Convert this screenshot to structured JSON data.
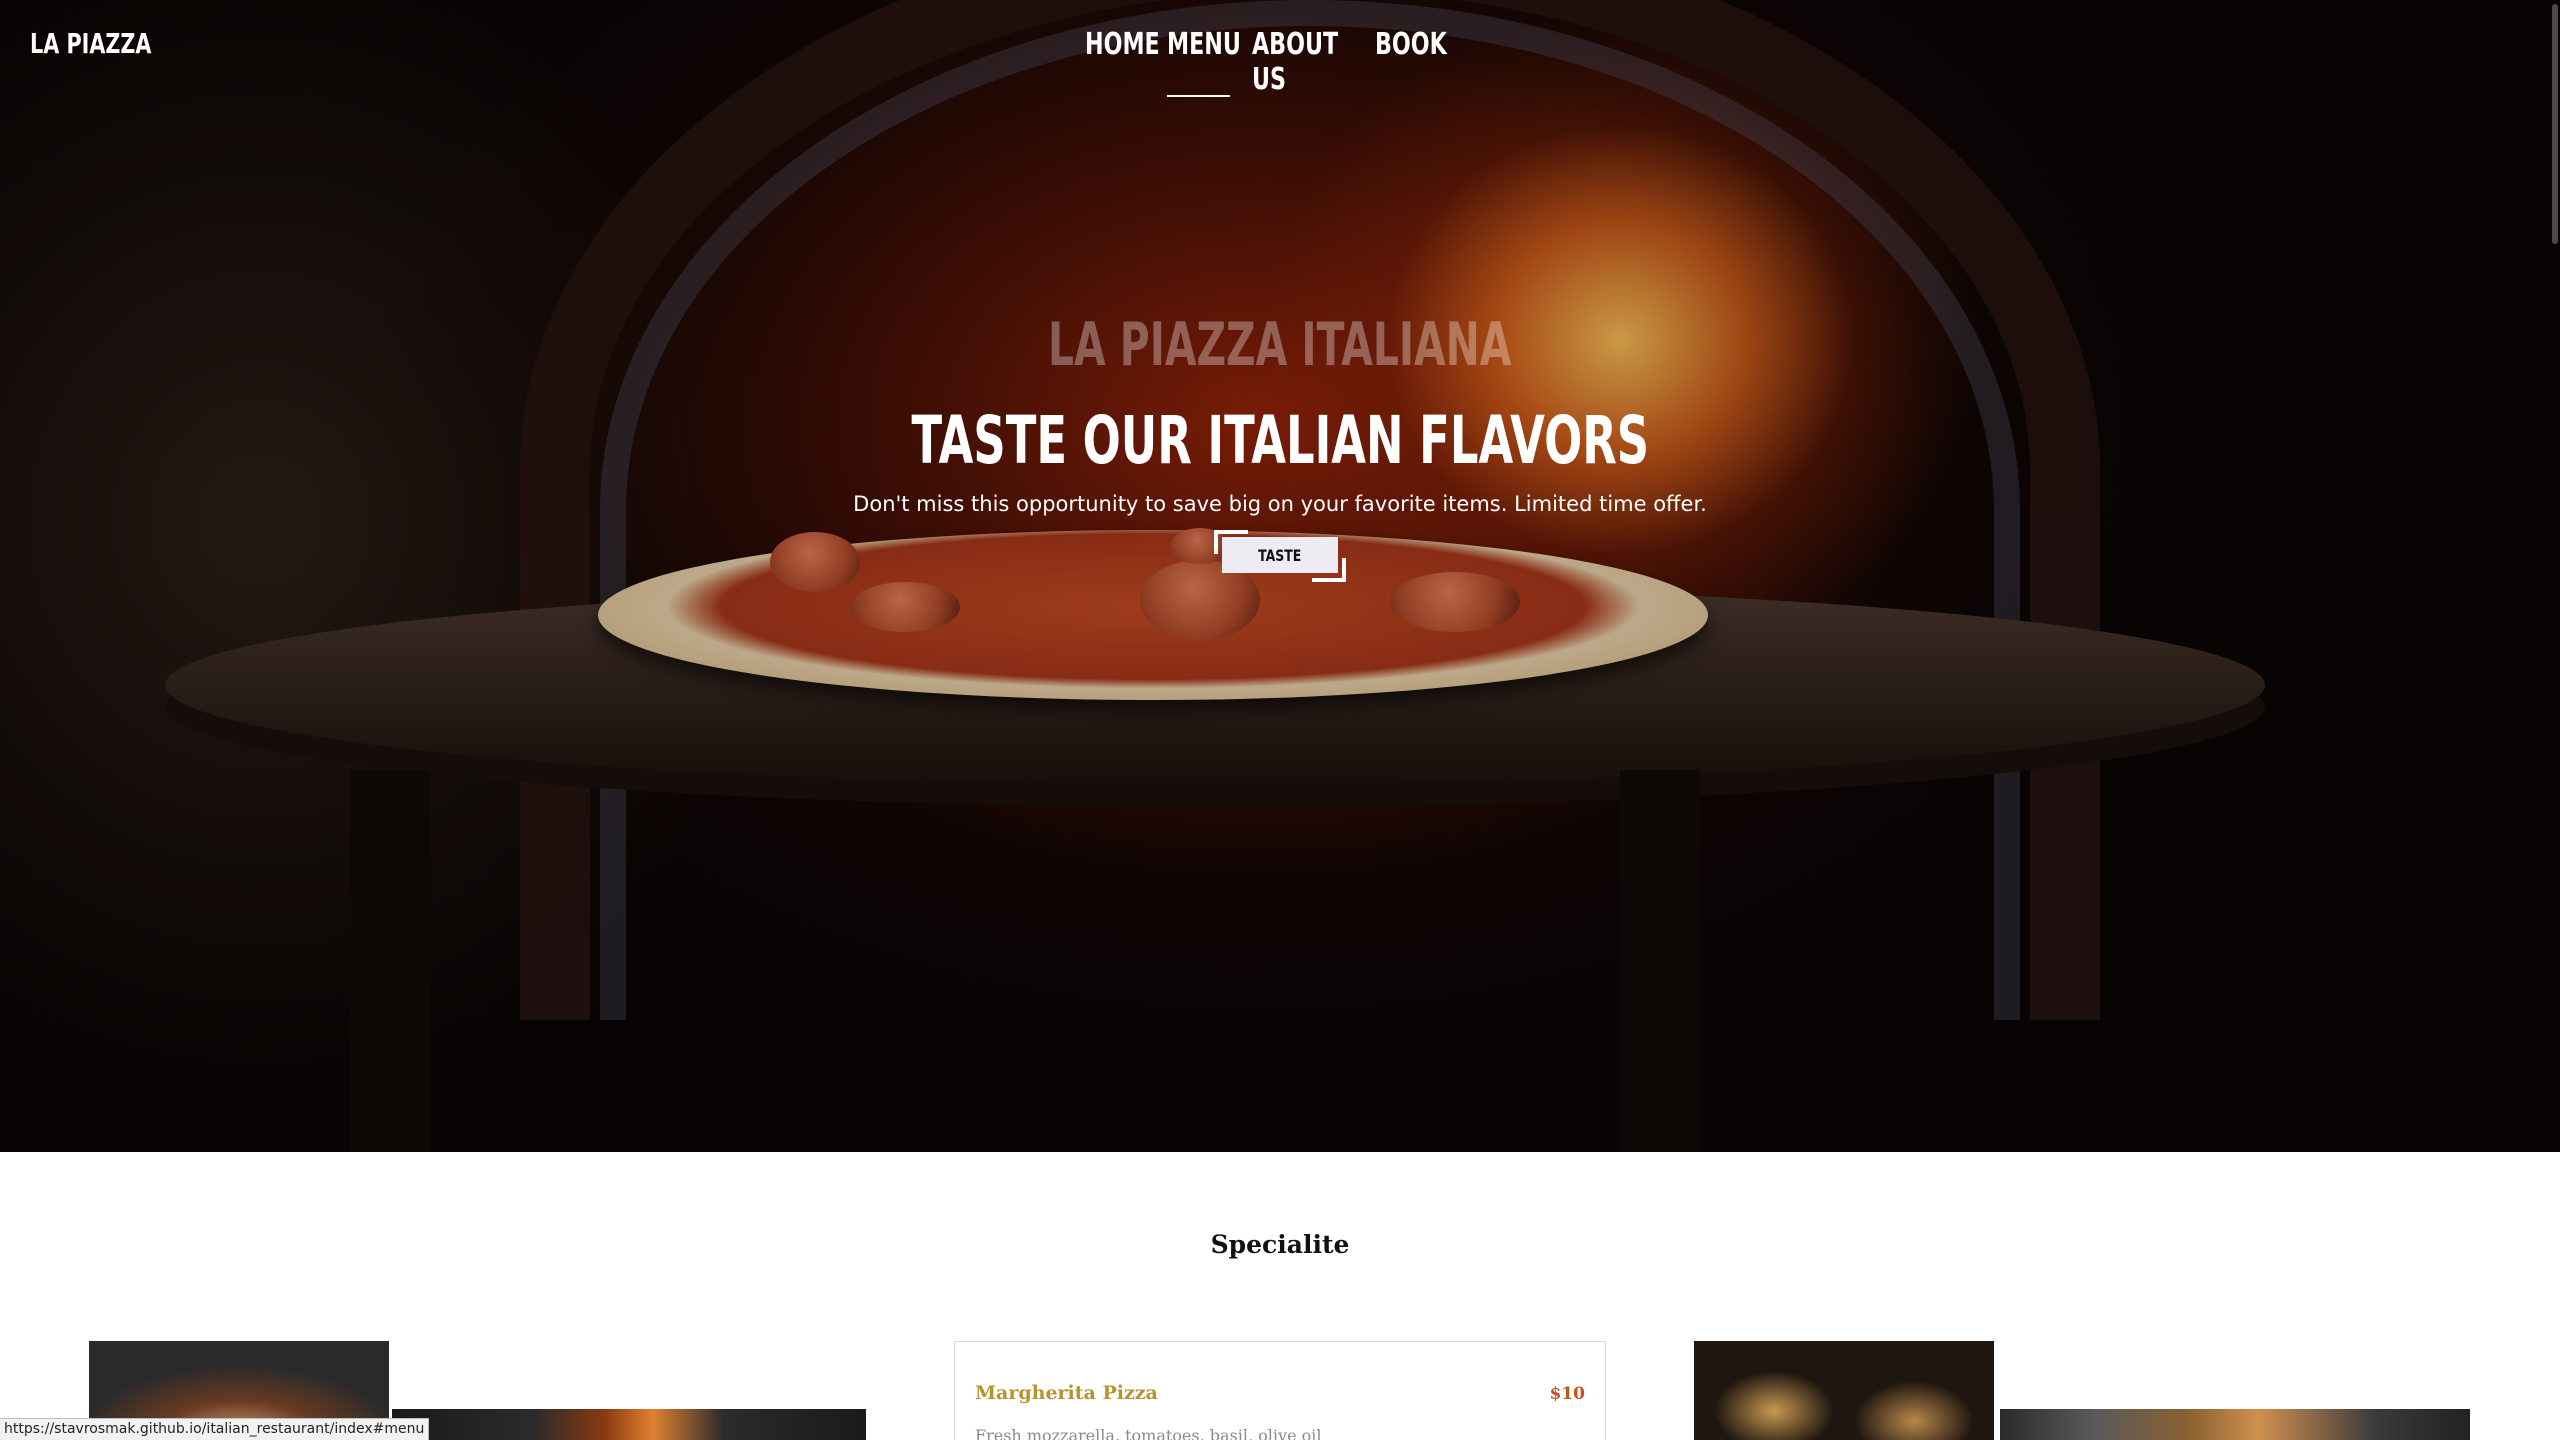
{
  "nav": {
    "logo": "LA PIAZZA",
    "links": [
      "HOME",
      "MENU",
      "ABOUT US",
      "BOOK"
    ],
    "active": "MENU"
  },
  "hero": {
    "supertitle": "LA PIAZZA ITALIANA",
    "title": "TASTE OUR ITALIAN FLAVORS",
    "subtitle": "Don't miss this opportunity to save big on your favorite items. Limited time offer.",
    "cta_label": "TASTE"
  },
  "specialite": {
    "title": "Specialite",
    "items": [
      {
        "name": "Margherita Pizza",
        "price": "$10",
        "description": "Fresh mozzarella, tomatoes, basil, olive oil"
      }
    ]
  },
  "status_bar": {
    "url": "https://stavrosmak.github.io/italian_restaurant/index#menu"
  },
  "colors": {
    "accent_gold": "#b8922f",
    "price_orange": "#c6511f"
  }
}
